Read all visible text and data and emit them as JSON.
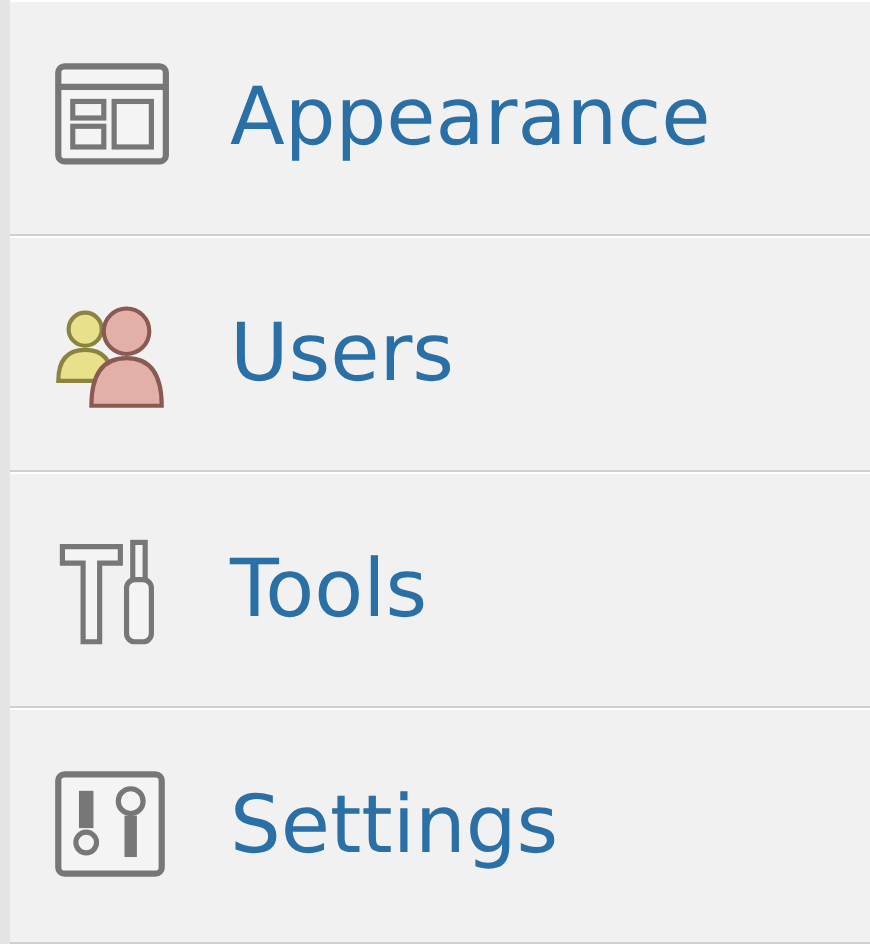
{
  "menu": {
    "items": [
      {
        "label": "Appearance",
        "kind": "appearance"
      },
      {
        "label": "Users",
        "kind": "users"
      },
      {
        "label": "Tools",
        "kind": "tools"
      },
      {
        "label": "Settings",
        "kind": "settings"
      }
    ]
  }
}
